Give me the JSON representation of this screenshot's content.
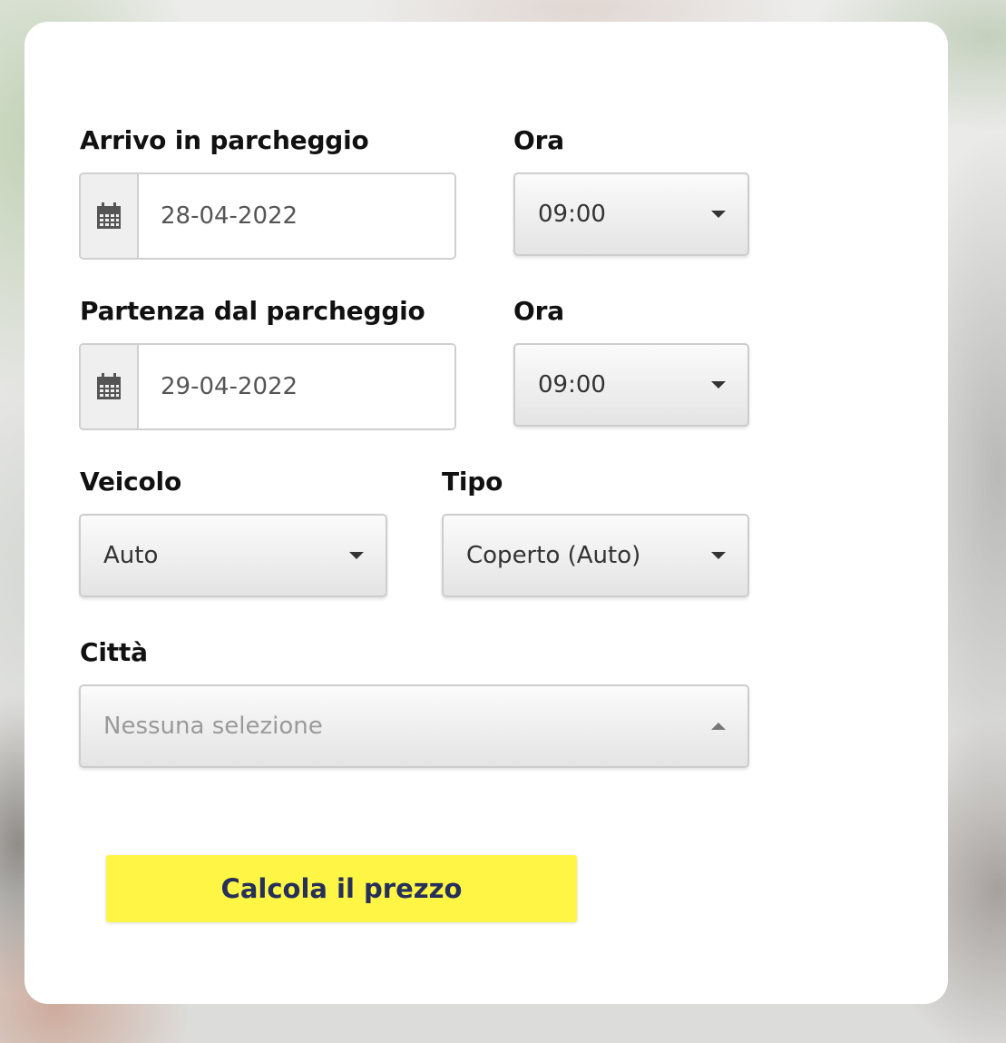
{
  "form": {
    "arrival": {
      "label": "Arrivo in parcheggio",
      "date_value": "28-04-2022",
      "date_icon": "calendar-icon",
      "time_label": "Ora",
      "time_value": "09:00"
    },
    "departure": {
      "label": "Partenza dal parcheggio",
      "date_value": "29-04-2022",
      "date_icon": "calendar-icon",
      "time_label": "Ora",
      "time_value": "09:00"
    },
    "vehicle": {
      "label": "Veicolo",
      "value": "Auto"
    },
    "type": {
      "label": "Tipo",
      "value": "Coperto (Auto)"
    },
    "city": {
      "label": "Città",
      "placeholder": "Nessuna selezione"
    },
    "submit_label": "Calcola il prezzo"
  },
  "colors": {
    "submit_bg": "#fff545",
    "submit_text": "#26305a",
    "label_text": "#111111",
    "card_bg": "#ffffff"
  }
}
